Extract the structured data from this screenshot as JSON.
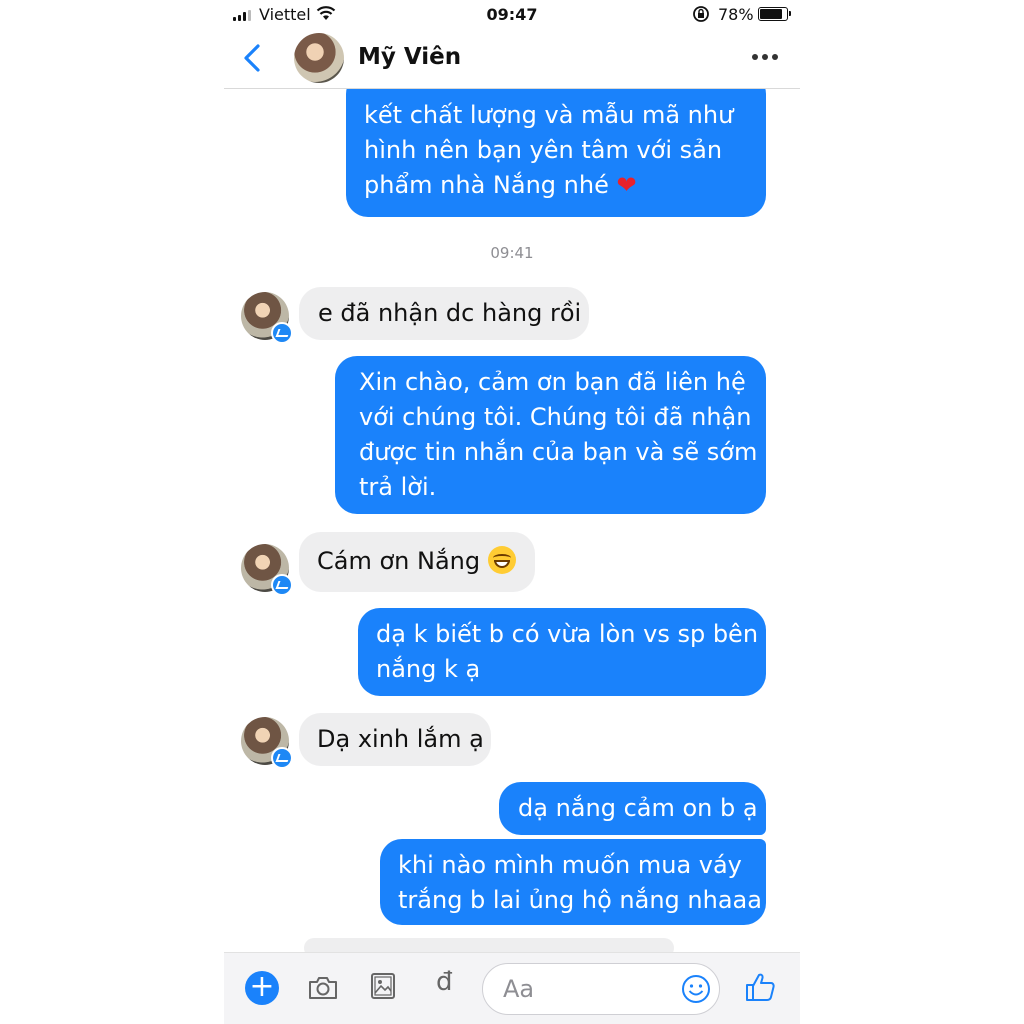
{
  "status_bar": {
    "carrier": "Viettel",
    "time": "09:47",
    "battery_percent": "78%",
    "battery_level": 0.78
  },
  "header": {
    "contact_name": "Mỹ Viên"
  },
  "messages": [
    {
      "from": "me",
      "lines": [
        "kết chất lượng và mẫu mã như",
        "hình nên bạn yên tâm với sản",
        "phẩm nhà Nắng nhé"
      ],
      "trailing_emoji": "❤️"
    },
    {
      "timestamp": "09:41"
    },
    {
      "from": "contact",
      "lines": [
        "e đã nhận dc hàng rồi"
      ]
    },
    {
      "from": "me",
      "lines": [
        "Xin chào, cảm ơn bạn đã liên hệ",
        "với chúng tôi. Chúng tôi đã nhận",
        "được tin nhắn của bạn và sẽ sớm",
        "trả lời."
      ]
    },
    {
      "from": "contact",
      "lines": [
        "Cám ơn Nắng"
      ],
      "trailing_emoji": "grinning-face"
    },
    {
      "from": "me",
      "lines": [
        "dạ k biết b có vừa lòn vs sp bên",
        "nắng k ạ"
      ]
    },
    {
      "from": "contact",
      "lines": [
        "Dạ xinh lắm ạ"
      ]
    },
    {
      "from": "me",
      "lines": [
        "dạ nắng cảm on b ạ"
      ]
    },
    {
      "from": "me",
      "lines": [
        "khi nào mình muốn mua váy",
        "trắng b lai ủng hộ nắng nhaaa"
      ]
    }
  ],
  "composer": {
    "placeholder": "Aa",
    "currency_symbol": "đ",
    "icons": [
      "plus-icon",
      "camera-icon",
      "image-icon",
      "dong-payment-icon",
      "emoji-icon",
      "thumbs-up-icon"
    ]
  },
  "colors": {
    "outgoing_bubble": "#1a82fb",
    "incoming_bubble": "#eeeeef",
    "accent": "#1a82fb"
  }
}
